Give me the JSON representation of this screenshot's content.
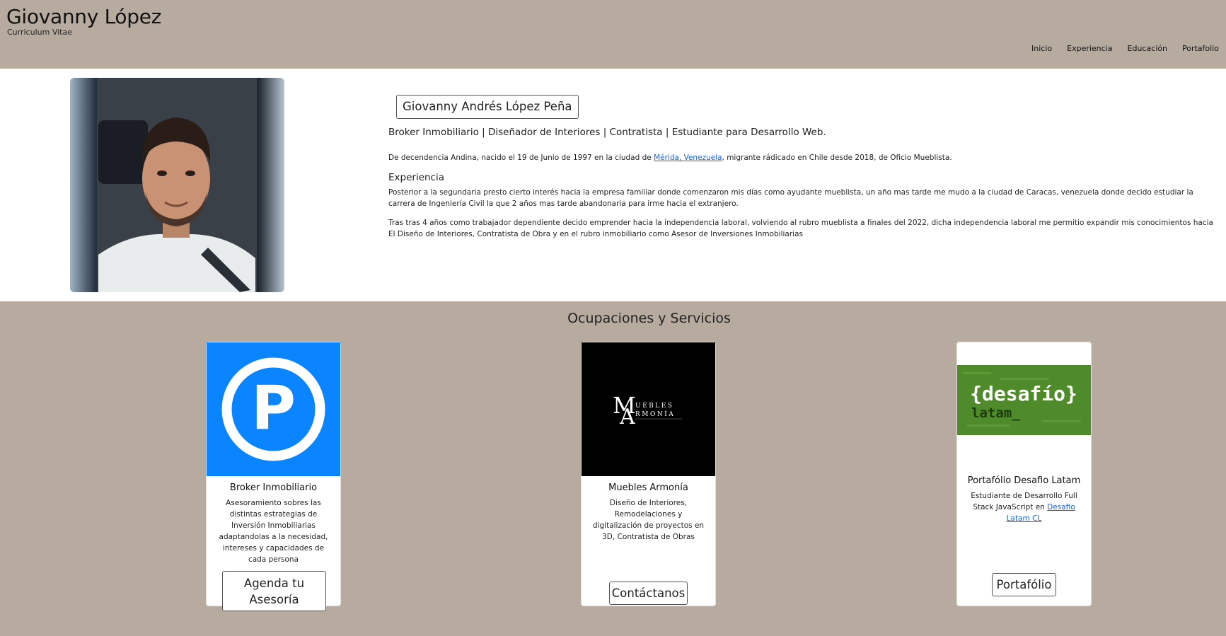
{
  "header": {
    "title": "Giovanny López",
    "subtitle": "Curriculum Vitae",
    "nav": [
      "Inicio",
      "Experiencia",
      "Educación",
      "Portafolio"
    ]
  },
  "profile": {
    "full_name": "Giovanny Andrés López Peña",
    "roles": "Broker Inmobiliario | Diseñador de Interiores | Contratista | Estudiante para Desarrollo Web.",
    "intro_before": "De decendencia Andina, nacido el 19 de Junio de 1997 en la ciudad de ",
    "intro_link": "Mérida, Venezuela",
    "intro_after": ", migrante rádicado en Chile desde 2018, de Oficio Mueblista.",
    "experience_title": "Experiencia",
    "experience_p1": "Posterior a la segundaria presto cierto interés hacia la empresa familiar donde comenzaron mis días como ayudante mueblista, un año mas tarde me mudo a la ciudad de Caracas, venezuela donde decido estudiar la carrera de Ingeniería Civil la que 2 años mas tarde abandonaria para irme hacia el extranjero.",
    "experience_p2": "Tras tras 4 años como trabajador dependiente decido emprender hacia la independencia laboral, volviendo al rubro mueblista a finales del 2022, dicha independencia laboral me permitio expandir mis conocimientos hacia El Diseño de Interiores, Contratista de Obra y en el rubro inmobiliario como Asesor de Inversiones Inmobiliarias"
  },
  "services": {
    "title": "Ocupaciones y Servicios",
    "cards": [
      {
        "title": "Broker Inmobiliario",
        "description": "Asesoramiento sobres las distintas estrategias de Inversión Inmobiliarias adaptandolas a la necesidad, intereses y capacidades de cada persona",
        "button_line1": "Agenda tu",
        "button_line2": "Asesoría",
        "logo_letter": "P"
      },
      {
        "title": "Muebles Armonía",
        "description": "Diseño de Interiores, Remodelaciones y digitalización de proyectos en 3D, Contratista de Obras",
        "button": "Contáctanos",
        "logo_m": "M",
        "logo_a": "A",
        "logo_word1": "UEBLES",
        "logo_word2": "RMONÍA"
      },
      {
        "title": "Portafólio Desafio Latam",
        "description_before": "Estudiante de Desarrollo Full Stack JavaScript en ",
        "description_link": "Desafio Latam CL",
        "button": "Portafólio",
        "logo_line1": "{desafío}",
        "logo_line2": "latam_"
      }
    ]
  },
  "colors": {
    "header_bg": "#b7ab9f",
    "link": "#1a5fd6",
    "broker_blue": "#0a84ff",
    "desafio_green": "#4f8a2b"
  }
}
